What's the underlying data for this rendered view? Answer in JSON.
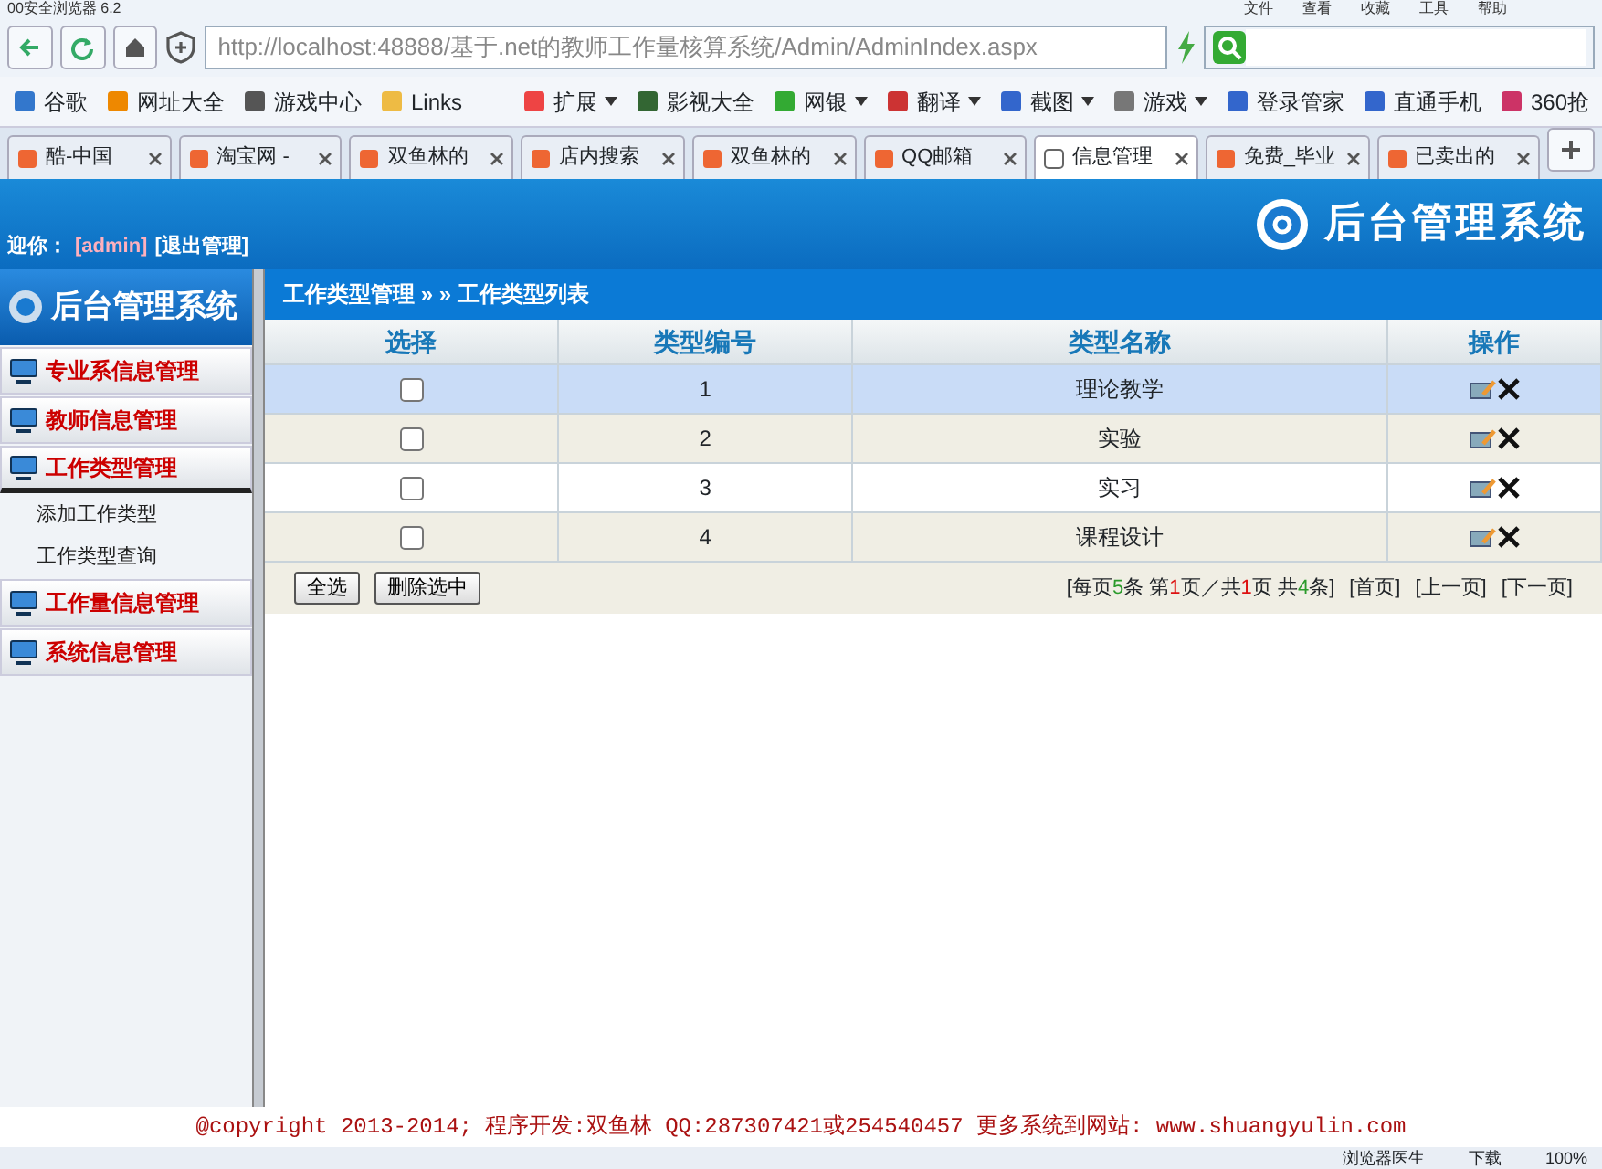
{
  "window": {
    "title": "00安全浏览器 6.2",
    "menu": [
      "文件",
      "查看",
      "收藏",
      "工具",
      "帮助"
    ]
  },
  "address_bar": {
    "url": "http://localhost:48888/基于.net的教师工作量核算系统/Admin/AdminIndex.aspx"
  },
  "bookmarks": [
    {
      "label": "谷歌",
      "dropdown": false
    },
    {
      "label": "网址大全",
      "dropdown": false
    },
    {
      "label": "游戏中心",
      "dropdown": false
    },
    {
      "label": "Links",
      "dropdown": false
    },
    {
      "label": "扩展",
      "dropdown": true
    },
    {
      "label": "影视大全",
      "dropdown": false
    },
    {
      "label": "网银",
      "dropdown": true
    },
    {
      "label": "翻译",
      "dropdown": true
    },
    {
      "label": "截图",
      "dropdown": true
    },
    {
      "label": "游戏",
      "dropdown": true
    },
    {
      "label": "登录管家",
      "dropdown": false
    },
    {
      "label": "直通手机",
      "dropdown": false
    },
    {
      "label": "360抢",
      "dropdown": false
    }
  ],
  "tabs": [
    {
      "label": "酷-中国",
      "selected": false
    },
    {
      "label": "淘宝网 -",
      "selected": false
    },
    {
      "label": "双鱼林的",
      "selected": false
    },
    {
      "label": "店内搜索",
      "selected": false
    },
    {
      "label": "双鱼林的",
      "selected": false
    },
    {
      "label": "QQ邮箱",
      "selected": false
    },
    {
      "label": "信息管理",
      "selected": true
    },
    {
      "label": "免费_毕业",
      "selected": false
    },
    {
      "label": "已卖出的",
      "selected": false
    }
  ],
  "header": {
    "title": "后台管理系统",
    "welcome": "迎你：",
    "user": "[admin]",
    "logout": "[退出管理]"
  },
  "sidebar": {
    "title": "后台管理系统",
    "items": [
      {
        "label": "专业系信息管理",
        "expanded": false
      },
      {
        "label": "教师信息管理",
        "expanded": false
      },
      {
        "label": "工作类型管理",
        "expanded": true,
        "children": [
          {
            "label": "添加工作类型"
          },
          {
            "label": "工作类型查询"
          }
        ]
      },
      {
        "label": "工作量信息管理",
        "expanded": false
      },
      {
        "label": "系统信息管理",
        "expanded": false
      }
    ]
  },
  "breadcrumb": "工作类型管理 » » 工作类型列表",
  "table": {
    "columns": [
      "选择",
      "类型编号",
      "类型名称",
      "操作"
    ],
    "rows": [
      {
        "id": "1",
        "name": "理论教学",
        "checked": false,
        "selected": true
      },
      {
        "id": "2",
        "name": "实验",
        "checked": false,
        "selected": false
      },
      {
        "id": "3",
        "name": "实习",
        "checked": false,
        "selected": false
      },
      {
        "id": "4",
        "name": "课程设计",
        "checked": false,
        "selected": false
      }
    ]
  },
  "buttons": [
    "全选",
    "删除选中"
  ],
  "pagination": {
    "summary": [
      {
        "text": "[每页",
        "kind": "plain"
      },
      {
        "text": "5",
        "kind": "count"
      },
      {
        "text": "条 第",
        "kind": "plain"
      },
      {
        "text": "1",
        "kind": "page"
      },
      {
        "text": "页／共",
        "kind": "plain"
      },
      {
        "text": "1",
        "kind": "page"
      },
      {
        "text": "页 共",
        "kind": "plain"
      },
      {
        "text": "4",
        "kind": "count"
      },
      {
        "text": "条]",
        "kind": "plain"
      }
    ],
    "links": [
      "[首页]",
      "[上一页]",
      "[下一页]"
    ]
  },
  "footer": {
    "text": "@copyright 2013-2014; 程序开发:双鱼林  QQ:287307421或254540457  更多系统到网站: ",
    "link": "www.shuangyulin.com"
  },
  "status_bar": [
    "浏览器医生",
    "下载",
    "100%"
  ]
}
